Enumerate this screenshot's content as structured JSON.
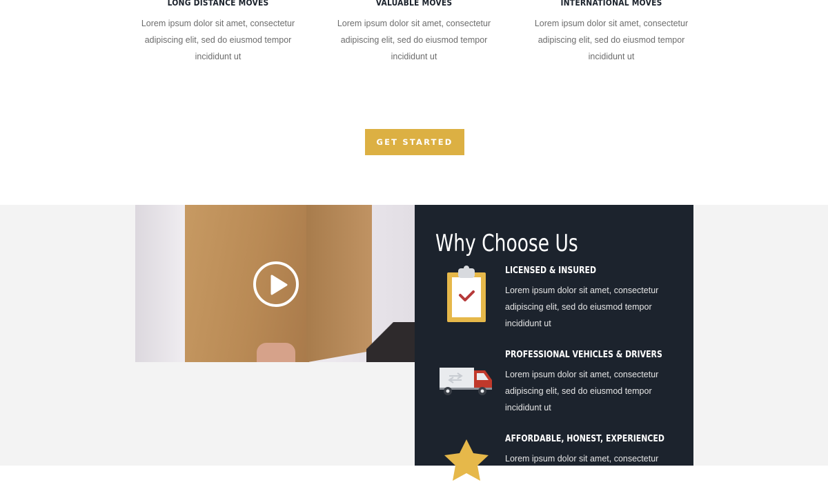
{
  "services": [
    {
      "title": "LONG DISTANCE MOVES",
      "text": "Lorem ipsum dolor sit amet, consectetur adipiscing elit, sed do eiusmod tempor incididunt ut"
    },
    {
      "title": "VALUABLE MOVES",
      "text": "Lorem ipsum dolor sit amet, consectetur adipiscing elit, sed do eiusmod tempor incididunt ut"
    },
    {
      "title": "INTERNATIONAL MOVES",
      "text": "Lorem ipsum dolor sit amet, consectetur adipiscing elit, sed do eiusmod tempor incididunt ut"
    }
  ],
  "cta": {
    "label": "GET STARTED"
  },
  "video": {
    "play_icon": "play-circle-icon"
  },
  "why": {
    "title": "Why Choose Us",
    "features": [
      {
        "title": "LICENSED & INSURED",
        "text": "Lorem ipsum dolor sit amet, consectetur adipiscing elit, sed do eiusmod tempor incididunt ut",
        "icon": "clipboard-check-icon"
      },
      {
        "title": "PROFESSIONAL VEHICLES & DRIVERS",
        "text": "Lorem ipsum dolor sit amet, consectetur adipiscing elit, sed do eiusmod tempor incididunt ut",
        "icon": "truck-icon"
      },
      {
        "title": "AFFORDABLE, HONEST, EXPERIENCED",
        "text": "Lorem ipsum dolor sit amet, consectetur",
        "icon": "star-icon"
      }
    ]
  },
  "colors": {
    "accent": "#dcb043",
    "dark_panel": "#1c232d",
    "section_bg": "#f3f3f3",
    "body_text": "#6c6c6c",
    "truck_red": "#c0392b"
  }
}
